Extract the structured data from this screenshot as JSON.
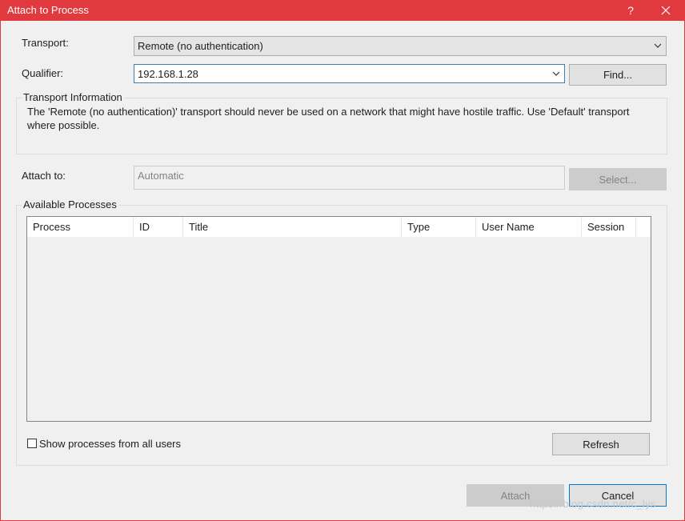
{
  "window": {
    "title": "Attach to Process",
    "help_label": "?",
    "close_label": "✕"
  },
  "transport": {
    "label": "Transport:",
    "value": "Remote (no authentication)"
  },
  "qualifier": {
    "label": "Qualifier:",
    "value": "192.168.1.28",
    "find_label": "Find..."
  },
  "transport_info": {
    "title": "Transport Information",
    "text": "The 'Remote (no authentication)' transport should never be used on a network that might have hostile traffic. Use 'Default' transport where possible."
  },
  "attach_to": {
    "label": "Attach to:",
    "value": "Automatic",
    "select_label": "Select..."
  },
  "processes": {
    "title": "Available Processes",
    "columns": [
      "Process",
      "ID",
      "Title",
      "Type",
      "User Name",
      "Session"
    ],
    "rows": [],
    "show_all_label": "Show processes from all users",
    "show_all_checked": false,
    "refresh_label": "Refresh"
  },
  "footer": {
    "attach_label": "Attach",
    "cancel_label": "Cancel"
  },
  "watermark": "https://blog.csdn.net/c_lys",
  "colors": {
    "titlebar": "#e03a3e",
    "focus_border": "#0078d7"
  }
}
